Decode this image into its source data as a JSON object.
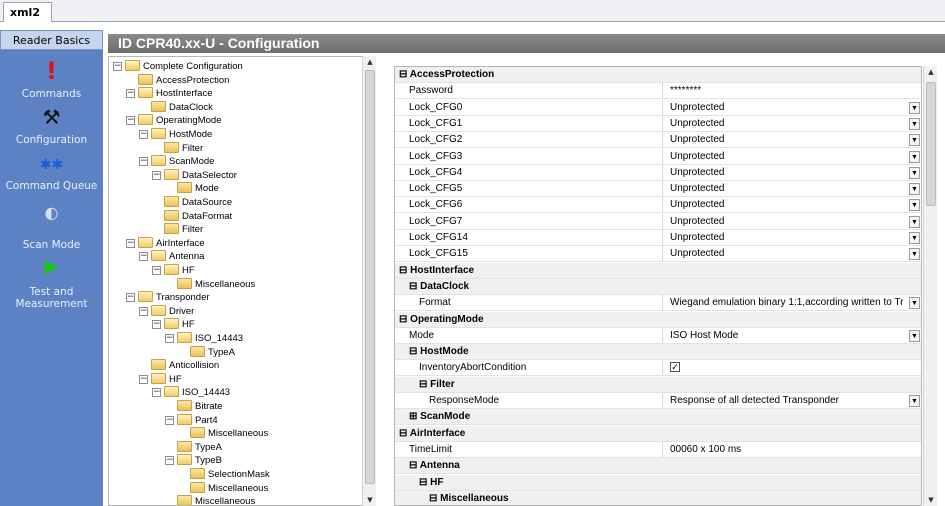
{
  "tab": {
    "label": "xml2"
  },
  "leftnav": {
    "header": "Reader Basics",
    "items": [
      {
        "label": "Commands",
        "icon": "exclamation-icon"
      },
      {
        "label": "Configuration",
        "icon": "tools-icon"
      },
      {
        "label": "Command Queue",
        "icon": "gears-icon"
      },
      {
        "label": "Scan Mode",
        "icon": "scan-icon"
      },
      {
        "label": "Test and Measurement",
        "icon": "play-icon"
      }
    ]
  },
  "title": "ID CPR40.xx-U - Configuration",
  "tree": [
    {
      "label": "Complete Configuration",
      "level": 0,
      "exp": "−"
    },
    {
      "label": "AccessProtection",
      "level": 1,
      "exp": ""
    },
    {
      "label": "HostInterface",
      "level": 1,
      "exp": "−"
    },
    {
      "label": "DataClock",
      "level": 2,
      "exp": ""
    },
    {
      "label": "OperatingMode",
      "level": 1,
      "exp": "−"
    },
    {
      "label": "HostMode",
      "level": 2,
      "exp": "−"
    },
    {
      "label": "Filter",
      "level": 3,
      "exp": ""
    },
    {
      "label": "ScanMode",
      "level": 2,
      "exp": "−"
    },
    {
      "label": "DataSelector",
      "level": 3,
      "exp": "−"
    },
    {
      "label": "Mode",
      "level": 4,
      "exp": ""
    },
    {
      "label": "DataSource",
      "level": 3,
      "exp": ""
    },
    {
      "label": "DataFormat",
      "level": 3,
      "exp": ""
    },
    {
      "label": "Filter",
      "level": 3,
      "exp": ""
    },
    {
      "label": "AirInterface",
      "level": 1,
      "exp": "−"
    },
    {
      "label": "Antenna",
      "level": 2,
      "exp": "−"
    },
    {
      "label": "HF",
      "level": 3,
      "exp": "−"
    },
    {
      "label": "Miscellaneous",
      "level": 4,
      "exp": ""
    },
    {
      "label": "Transponder",
      "level": 1,
      "exp": "−"
    },
    {
      "label": "Driver",
      "level": 2,
      "exp": "−"
    },
    {
      "label": "HF",
      "level": 3,
      "exp": "−"
    },
    {
      "label": "ISO_14443",
      "level": 4,
      "exp": "−"
    },
    {
      "label": "TypeA",
      "level": 5,
      "exp": ""
    },
    {
      "label": "Anticollision",
      "level": 2,
      "exp": ""
    },
    {
      "label": "HF",
      "level": 2,
      "exp": "−"
    },
    {
      "label": "ISO_14443",
      "level": 3,
      "exp": "−"
    },
    {
      "label": "Bitrate",
      "level": 4,
      "exp": ""
    },
    {
      "label": "Part4",
      "level": 4,
      "exp": "−"
    },
    {
      "label": "Miscellaneous",
      "level": 5,
      "exp": ""
    },
    {
      "label": "TypeA",
      "level": 4,
      "exp": ""
    },
    {
      "label": "TypeB",
      "level": 4,
      "exp": "−"
    },
    {
      "label": "SelectionMask",
      "level": 5,
      "exp": ""
    },
    {
      "label": "Miscellaneous",
      "level": 5,
      "exp": ""
    },
    {
      "label": "Miscellaneous",
      "level": 4,
      "exp": ""
    }
  ],
  "grid": [
    {
      "type": "cat",
      "label": "AccessProtection",
      "indent": 0,
      "exp": "⊟"
    },
    {
      "type": "prop",
      "label": "Password",
      "value": "********",
      "indent": 0
    },
    {
      "type": "prop",
      "label": "Lock_CFG0",
      "value": "Unprotected",
      "indent": 0,
      "dropdown": true
    },
    {
      "type": "prop",
      "label": "Lock_CFG1",
      "value": "Unprotected",
      "indent": 0,
      "dropdown": true
    },
    {
      "type": "prop",
      "label": "Lock_CFG2",
      "value": "Unprotected",
      "indent": 0,
      "dropdown": true
    },
    {
      "type": "prop",
      "label": "Lock_CFG3",
      "value": "Unprotected",
      "indent": 0,
      "dropdown": true
    },
    {
      "type": "prop",
      "label": "Lock_CFG4",
      "value": "Unprotected",
      "indent": 0,
      "dropdown": true
    },
    {
      "type": "prop",
      "label": "Lock_CFG5",
      "value": "Unprotected",
      "indent": 0,
      "dropdown": true
    },
    {
      "type": "prop",
      "label": "Lock_CFG6",
      "value": "Unprotected",
      "indent": 0,
      "dropdown": true
    },
    {
      "type": "prop",
      "label": "Lock_CFG7",
      "value": "Unprotected",
      "indent": 0,
      "dropdown": true
    },
    {
      "type": "prop",
      "label": "Lock_CFG14",
      "value": "Unprotected",
      "indent": 0,
      "dropdown": true
    },
    {
      "type": "prop",
      "label": "Lock_CFG15",
      "value": "Unprotected",
      "indent": 0,
      "dropdown": true
    },
    {
      "type": "cat",
      "label": "HostInterface",
      "indent": 0,
      "exp": "⊟"
    },
    {
      "type": "cat",
      "label": "DataClock",
      "indent": 1,
      "exp": "⊟"
    },
    {
      "type": "prop",
      "label": "Format",
      "value": "Wiegand emulation binary 1:1,according written to Tr",
      "indent": 1,
      "dropdown": true
    },
    {
      "type": "cat",
      "label": "OperatingMode",
      "indent": 0,
      "exp": "⊟"
    },
    {
      "type": "prop",
      "label": "Mode",
      "value": "ISO Host Mode",
      "indent": 0,
      "dropdown": true
    },
    {
      "type": "cat",
      "label": "HostMode",
      "indent": 1,
      "exp": "⊟"
    },
    {
      "type": "prop",
      "label": "InventoryAbortCondition",
      "value": "",
      "indent": 1,
      "checkbox": true
    },
    {
      "type": "cat",
      "label": "Filter",
      "indent": 2,
      "exp": "⊟"
    },
    {
      "type": "prop",
      "label": "ResponseMode",
      "value": "Response of all detected Transponder",
      "indent": 2,
      "dropdown": true
    },
    {
      "type": "cat",
      "label": "ScanMode",
      "indent": 1,
      "exp": "⊞"
    },
    {
      "type": "cat",
      "label": "AirInterface",
      "indent": 0,
      "exp": "⊟"
    },
    {
      "type": "prop",
      "label": "TimeLimit",
      "value": "00060 x 100 ms",
      "indent": 0
    },
    {
      "type": "cat",
      "label": "Antenna",
      "indent": 1,
      "exp": "⊟"
    },
    {
      "type": "cat",
      "label": "HF",
      "indent": 2,
      "exp": "⊟"
    },
    {
      "type": "cat",
      "label": "Miscellaneous",
      "indent": 3,
      "exp": "⊟"
    }
  ]
}
